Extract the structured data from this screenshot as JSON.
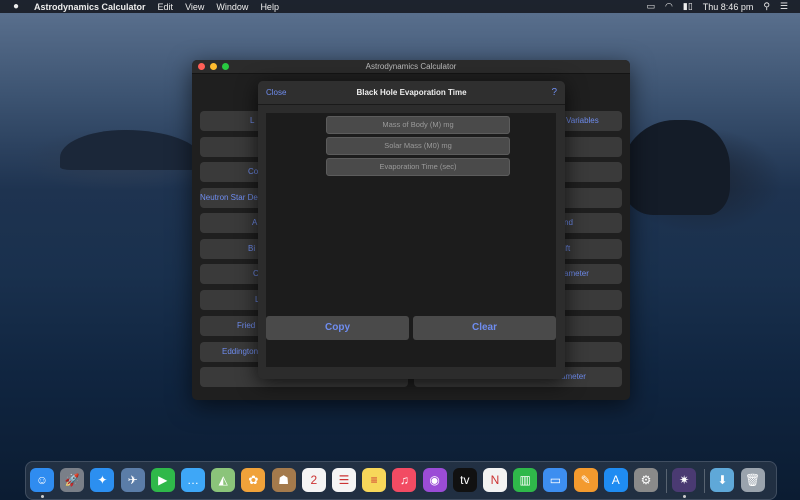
{
  "menubar": {
    "app_name": "Astrodynamics Calculator",
    "menus": [
      "Edit",
      "View",
      "Window",
      "Help"
    ],
    "clock": "Thu 8:46 pm"
  },
  "window": {
    "title": "Astrodynamics Calculator",
    "left_buttons": [
      "L",
      "",
      "Co",
      "Neutron Star Deg",
      "A",
      "Bi",
      "C",
      "L",
      "Fried",
      "Eddington",
      ""
    ],
    "right_buttons": [
      "Variables",
      "",
      "",
      "",
      "nd",
      "ift",
      "ameter",
      "",
      "",
      "",
      "ameter"
    ]
  },
  "sheet": {
    "close_label": "Close",
    "title": "Black Hole Evaporation Time",
    "help_label": "?",
    "fields": [
      {
        "placeholder": "Mass of Body (M) mg",
        "value": ""
      },
      {
        "placeholder": "Solar Mass (M0) mg",
        "value": ""
      },
      {
        "placeholder": "Evaporation Time (sec)",
        "value": ""
      }
    ],
    "copy_label": "Copy",
    "clear_label": "Clear"
  },
  "dock": {
    "apps": [
      {
        "name": "finder-icon",
        "glyph": "☺",
        "color": "#2f8cf0"
      },
      {
        "name": "launchpad-icon",
        "glyph": "🚀",
        "color": "#7a7f88"
      },
      {
        "name": "safari-icon",
        "glyph": "✦",
        "color": "#2c8ff0"
      },
      {
        "name": "photo-preview-icon",
        "glyph": "✈",
        "color": "#5b7da8"
      },
      {
        "name": "facetime-icon",
        "glyph": "▶",
        "color": "#2fb84a"
      },
      {
        "name": "messages-icon",
        "glyph": "…",
        "color": "#3ea7f7"
      },
      {
        "name": "maps-icon",
        "glyph": "◭",
        "color": "#8bc47a"
      },
      {
        "name": "photos-icon",
        "glyph": "✿",
        "color": "#f0a23a"
      },
      {
        "name": "contacts-icon",
        "glyph": "☗",
        "color": "#a47a4c"
      },
      {
        "name": "calendar-icon",
        "glyph": "2",
        "color": "#f4f4f4"
      },
      {
        "name": "reminders-icon",
        "glyph": "☰",
        "color": "#f4f4f4"
      },
      {
        "name": "notes-icon",
        "glyph": "≡",
        "color": "#f7d75a"
      },
      {
        "name": "music-icon",
        "glyph": "♫",
        "color": "#f24b63"
      },
      {
        "name": "podcasts-icon",
        "glyph": "◉",
        "color": "#9b4cd6"
      },
      {
        "name": "apple-tv-icon",
        "glyph": "tv",
        "color": "#111111"
      },
      {
        "name": "news-icon",
        "glyph": "N",
        "color": "#f2f2f2"
      },
      {
        "name": "numbers-icon",
        "glyph": "▥",
        "color": "#2fb84a"
      },
      {
        "name": "keynote-icon",
        "glyph": "▭",
        "color": "#3d8ef0"
      },
      {
        "name": "pages-icon",
        "glyph": "✎",
        "color": "#f39a2e"
      },
      {
        "name": "app-store-icon",
        "glyph": "A",
        "color": "#1f8cf2"
      },
      {
        "name": "system-preferences-icon",
        "glyph": "⚙",
        "color": "#8a8a8a"
      },
      {
        "name": "astrodynamics-app-icon",
        "glyph": "✷",
        "color": "#4a3a72"
      },
      {
        "name": "downloads-folder-icon",
        "glyph": "⬇",
        "color": "#5fa8d8"
      },
      {
        "name": "trash-icon",
        "glyph": "🗑",
        "color": "#9aa3ad"
      }
    ]
  }
}
